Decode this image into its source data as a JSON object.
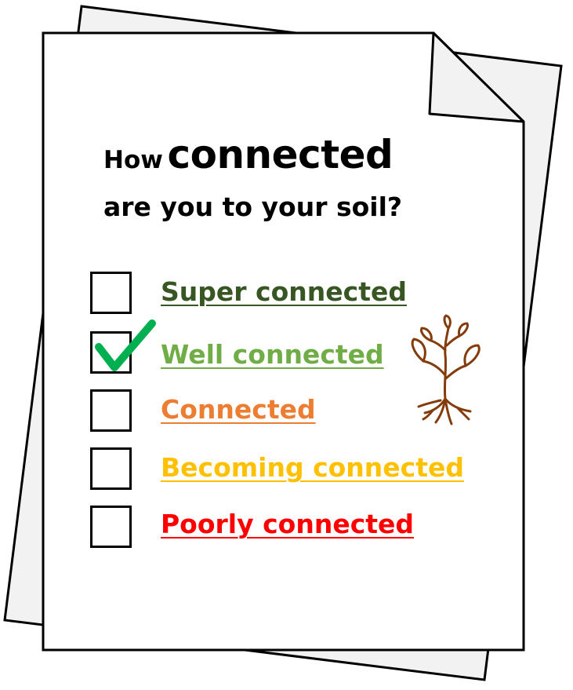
{
  "heading": {
    "word_how": "How",
    "word_connected": "connected",
    "line2": "are you to your soil?"
  },
  "options": [
    {
      "label": "Super connected",
      "color": "#375623",
      "checked": false
    },
    {
      "label": "Well connected",
      "color": "#70AD47",
      "checked": true
    },
    {
      "label": "Connected",
      "color": "#ED7D31",
      "checked": false
    },
    {
      "label": "Becoming connected",
      "color": "#FFC000",
      "checked": false
    },
    {
      "label": "Poorly connected",
      "color": "#FF0000",
      "checked": false
    }
  ],
  "icons": {
    "check": "checkmark-icon",
    "plant": "plant-icon",
    "check_color": "#00B050",
    "plant_color": "#843C0C"
  }
}
